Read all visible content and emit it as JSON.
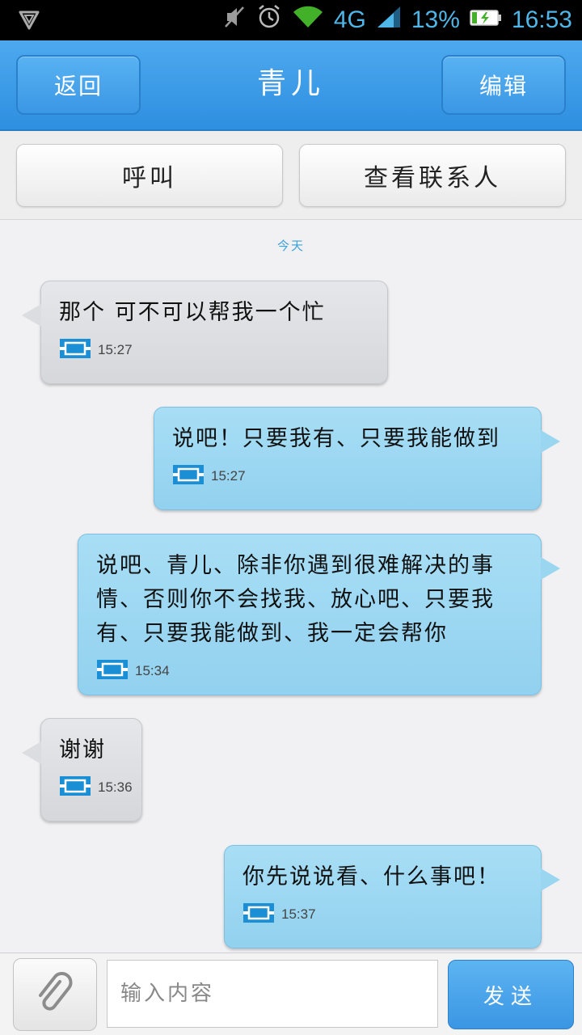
{
  "status_bar": {
    "network": "4G",
    "battery": "13%",
    "time": "16:53"
  },
  "header": {
    "back_label": "返回",
    "title": "青儿",
    "edit_label": "编辑"
  },
  "actions": {
    "call_label": "呼叫",
    "view_contact_label": "查看联系人"
  },
  "conversation": {
    "day_label": "今天",
    "messages": [
      {
        "direction": "incoming",
        "text": "那个 可不可以帮我一个忙",
        "time": "15:27"
      },
      {
        "direction": "outgoing",
        "text": "说吧！只要我有、只要我能做到",
        "time": "15:27"
      },
      {
        "direction": "outgoing",
        "text": "说吧、青儿、除非你遇到很难解决的事情、否则你不会找我、放心吧、只要我有、只要我能做到、我一定会帮你",
        "time": "15:34"
      },
      {
        "direction": "incoming",
        "text": "谢谢",
        "time": "15:36"
      },
      {
        "direction": "outgoing",
        "text": "你先说说看、什么事吧！",
        "time": "15:37"
      }
    ]
  },
  "composer": {
    "placeholder": "输入内容",
    "send_label": "发送"
  },
  "colors": {
    "accent": "#3b96e3",
    "incoming_bubble": "#d9dade",
    "outgoing_bubble": "#9bd6f1",
    "sim_icon": "#1a8fd6"
  }
}
